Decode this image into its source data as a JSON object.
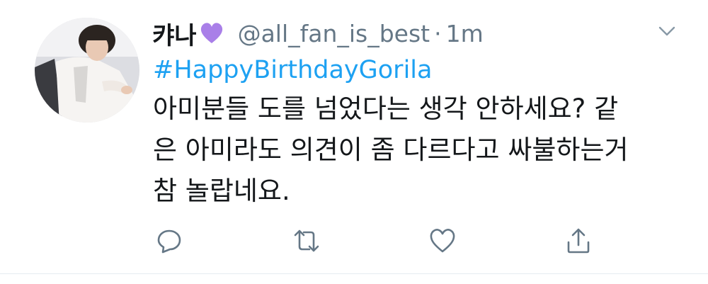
{
  "tweet": {
    "display_name": "캬나",
    "name_emoji": "purple-heart",
    "handle": "@all_fan_is_best",
    "separator": "·",
    "time": "1m",
    "hashtag": "#HappyBirthdayGorila",
    "body_lines": [
      "아미분들 도를 넘었다는 생각 안하세요? 같",
      "은 아미라도 의견이 좀 다르다고 싸불하는거",
      "참 놀랍네요."
    ]
  },
  "actions": {
    "reply_icon": "reply-icon",
    "retweet_icon": "retweet-icon",
    "like_icon": "heart-icon",
    "share_icon": "share-icon"
  },
  "colors": {
    "text": "#14171a",
    "secondary": "#657786",
    "link": "#1da1f2",
    "emoji_purple": "#a97fe8"
  }
}
